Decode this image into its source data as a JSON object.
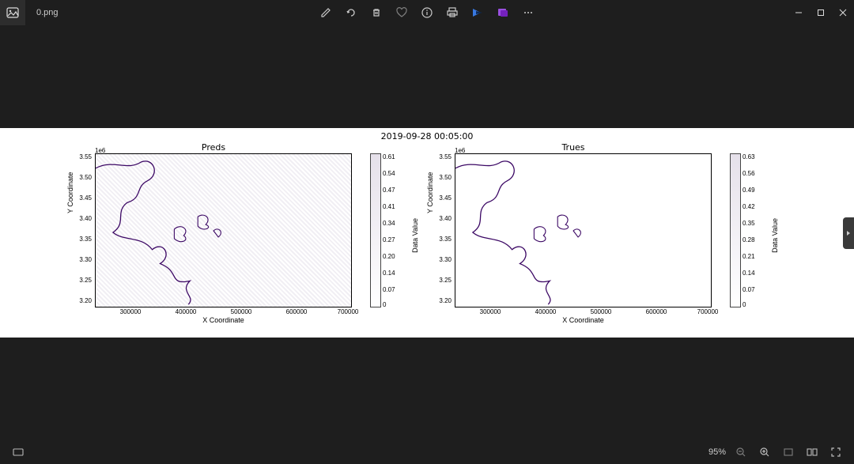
{
  "filename": "0.png",
  "suptitle": "2019-09-28 00:05:00",
  "panels": {
    "preds": {
      "title": "Preds",
      "xlabel": "X Coordinate",
      "ylabel": "Y Coordinate"
    },
    "trues": {
      "title": "Trues",
      "xlabel": "X Coordinate",
      "ylabel": "Y Coordinate"
    }
  },
  "zoom_level": "95%",
  "chart_data": [
    {
      "type": "heatmap",
      "series_name": "Preds",
      "title": "Preds",
      "xlabel": "X Coordinate",
      "ylabel": "Y Coordinate",
      "x_scale_note": "1e6",
      "x_ticks": [
        300000,
        400000,
        500000,
        600000,
        700000
      ],
      "y_ticks": [
        3.2,
        3.25,
        3.3,
        3.35,
        3.4,
        3.45,
        3.5,
        3.55
      ],
      "xlim": [
        250000,
        710000
      ],
      "ylim": [
        3.18,
        3.57
      ],
      "colorbar": {
        "label": "Data Value",
        "ticks": [
          0.0,
          0.07,
          0.14,
          0.2,
          0.27,
          0.34,
          0.41,
          0.47,
          0.54,
          0.61
        ],
        "range": [
          0.0,
          0.61
        ]
      }
    },
    {
      "type": "heatmap",
      "series_name": "Trues",
      "title": "Trues",
      "xlabel": "X Coordinate",
      "ylabel": "Y Coordinate",
      "x_scale_note": "1e6",
      "x_ticks": [
        300000,
        400000,
        500000,
        600000,
        700000
      ],
      "y_ticks": [
        3.2,
        3.25,
        3.3,
        3.35,
        3.4,
        3.45,
        3.5,
        3.55
      ],
      "xlim": [
        250000,
        710000
      ],
      "ylim": [
        3.18,
        3.57
      ],
      "colorbar": {
        "label": "Data Value",
        "ticks": [
          0.0,
          0.07,
          0.14,
          0.21,
          0.28,
          0.35,
          0.42,
          0.49,
          0.56,
          0.63
        ],
        "range": [
          0.0,
          0.63
        ]
      }
    }
  ]
}
